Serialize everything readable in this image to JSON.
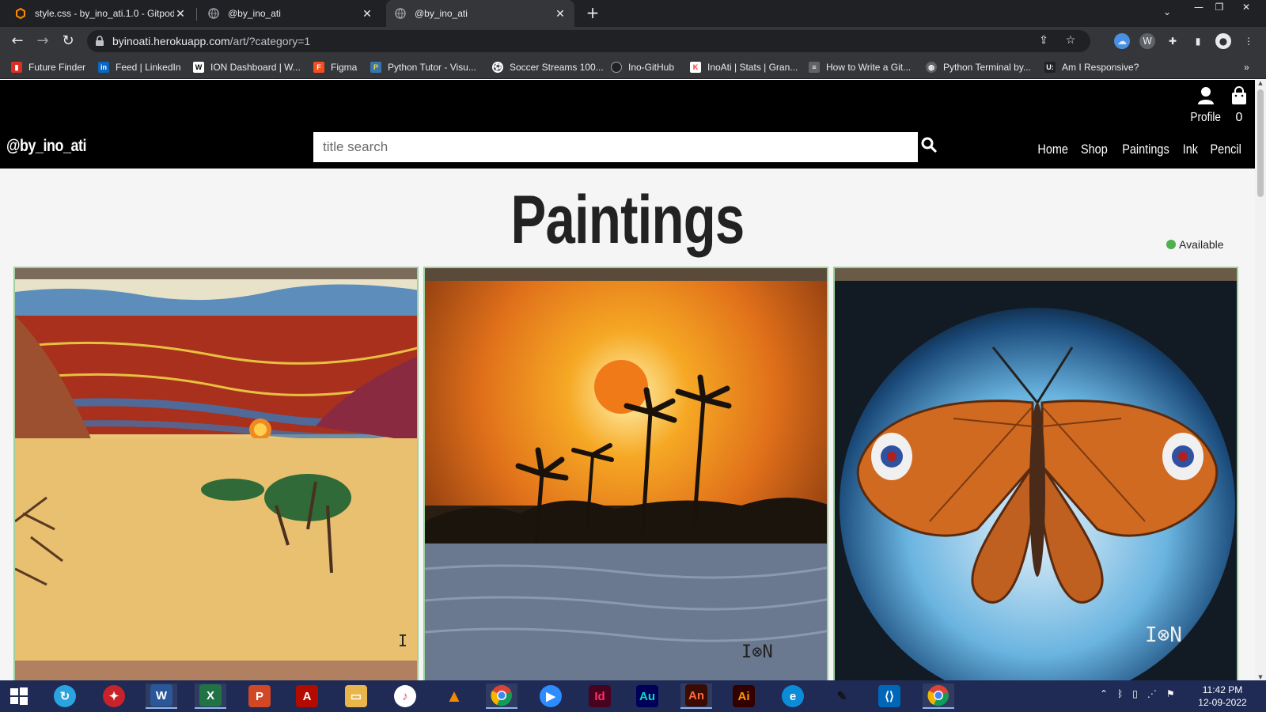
{
  "browser": {
    "tabs": [
      {
        "title": "style.css - by_ino_ati.1.0 - Gitpod"
      },
      {
        "title": "@by_ino_ati"
      },
      {
        "title": "@by_ino_ati"
      }
    ],
    "url": {
      "domain": "byinoati.herokuapp.com",
      "path": "/art/?category=1"
    },
    "bookmarks": [
      {
        "label": "Future Finder",
        "icon": "future-finder-icon",
        "color": "#d93025"
      },
      {
        "label": "Feed | LinkedIn",
        "icon": "linkedin-icon",
        "color": "#0a66c2"
      },
      {
        "label": "ION Dashboard | W...",
        "icon": "wix-icon",
        "color": "#ffffff"
      },
      {
        "label": "Figma",
        "icon": "figma-icon",
        "color": "#f24e1e"
      },
      {
        "label": "Python Tutor - Visu...",
        "icon": "python-icon",
        "color": "#3776ab"
      },
      {
        "label": "Soccer Streams 100...",
        "icon": "soccer-icon",
        "color": "#ffffff"
      },
      {
        "label": "Ino-GitHub",
        "icon": "github-icon",
        "color": "#202124"
      },
      {
        "label": "InoAti | Stats | Gran...",
        "icon": "k-icon",
        "color": "#ff3333"
      },
      {
        "label": "How to Write a Git...",
        "icon": "doc-icon",
        "color": "#5f6368"
      },
      {
        "label": "Python Terminal by...",
        "icon": "globe-icon",
        "color": "#5f6368"
      },
      {
        "label": "Am I Responsive?",
        "icon": "u-icon",
        "color": "#202124"
      }
    ]
  },
  "site": {
    "brand": "@by_ino_ati",
    "search_placeholder": "title search",
    "profile_label": "Profile",
    "bag_count": "0",
    "nav": [
      "Home",
      "Shop",
      "Paintings",
      "Ink",
      "Pencil"
    ]
  },
  "page": {
    "title": "Paintings",
    "legend": "Available",
    "legend_color": "#4caf50"
  },
  "artworks": [
    {
      "subject": "desert-sunset-painting"
    },
    {
      "subject": "palm-sunset-painting"
    },
    {
      "subject": "peacock-butterfly-painting"
    }
  ],
  "taskbar": {
    "apps": [
      "start",
      "teams",
      "antivirus",
      "word",
      "excel",
      "powerpoint",
      "acrobat",
      "file-explorer",
      "itunes",
      "vlc",
      "chrome",
      "zoom",
      "indesign",
      "audition",
      "animate",
      "illustrator",
      "edge",
      "pen",
      "vscode",
      "chrome"
    ],
    "time": "11:42 PM",
    "date": "12-09-2022"
  }
}
